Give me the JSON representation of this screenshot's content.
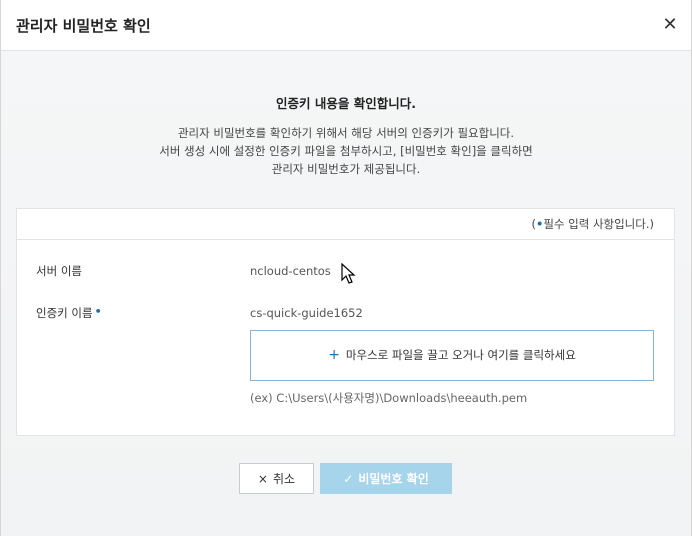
{
  "dialog": {
    "title": "관리자 비밀번호 확인",
    "close_icon": "close-icon"
  },
  "intro": {
    "headline": "인증키 내용을 확인합니다.",
    "lines": [
      "관리자 비밀번호를 확인하기 위해서 해당 서버의 인증키가 필요합니다.",
      "서버 생성 시에 설정한 인증키 파일을 첨부하시고, [비밀번호 확인]을 클릭하면",
      "관리자 비밀번호가 제공됩니다."
    ]
  },
  "form": {
    "required_note_prefix": "(",
    "required_dot": "•",
    "required_note_text": "필수 입력 사항입니다.)",
    "server_name_label": "서버 이름",
    "server_name_value": "ncloud-centos",
    "key_name_label": "인증키 이름",
    "key_name_value": "cs-quick-guide1652",
    "dropzone_plus": "+",
    "dropzone_text": "마우스로 파일을 끌고 오거나 여기를 클릭하세요",
    "example_path": "(ex) C:\\Users\\(사용자명)\\Downloads\\heeauth.pem"
  },
  "buttons": {
    "cancel_icon": "×",
    "cancel_label": "취소",
    "confirm_icon": "✓",
    "confirm_label": "비밀번호 확인"
  },
  "colors": {
    "accent": "#1f6fb2",
    "confirm_disabled": "#a6d4ea"
  }
}
